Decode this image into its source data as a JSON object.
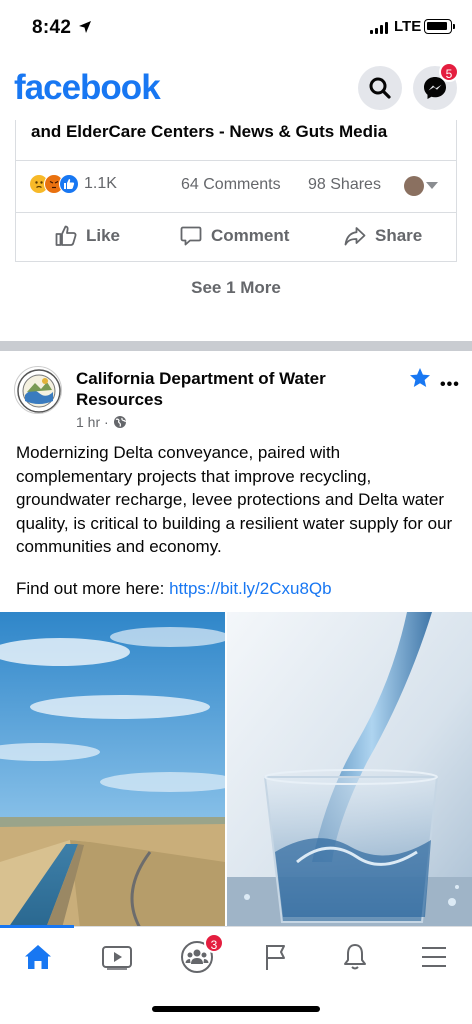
{
  "status": {
    "time": "8:42",
    "network": "LTE"
  },
  "header": {
    "logo": "facebook",
    "messenger_badge": "5"
  },
  "previous_post": {
    "title_line": "and ElderCare Centers - News & Guts Media",
    "reactions_count": "1.1K",
    "comments": "64 Comments",
    "shares": "98 Shares",
    "actions": {
      "like": "Like",
      "comment": "Comment",
      "share": "Share"
    },
    "see_more": "See 1 More"
  },
  "post": {
    "page_name": "California Department of Water Resources",
    "time": "1 hr ·",
    "body": "Modernizing Delta conveyance, paired with complementary projects that improve recycling, groundwater recharge, levee protections and Delta water quality, is critical to building a resilient water supply for our communities and economy.",
    "link_prefix": "Find out more here: ",
    "link": "https://bit.ly/2Cxu8Qb"
  },
  "tabbar": {
    "groups_badge": "3",
    "active_tab": "home"
  },
  "colors": {
    "brand": "#1877f2",
    "badge": "#e41e3f",
    "secondary_text": "#65676b"
  }
}
